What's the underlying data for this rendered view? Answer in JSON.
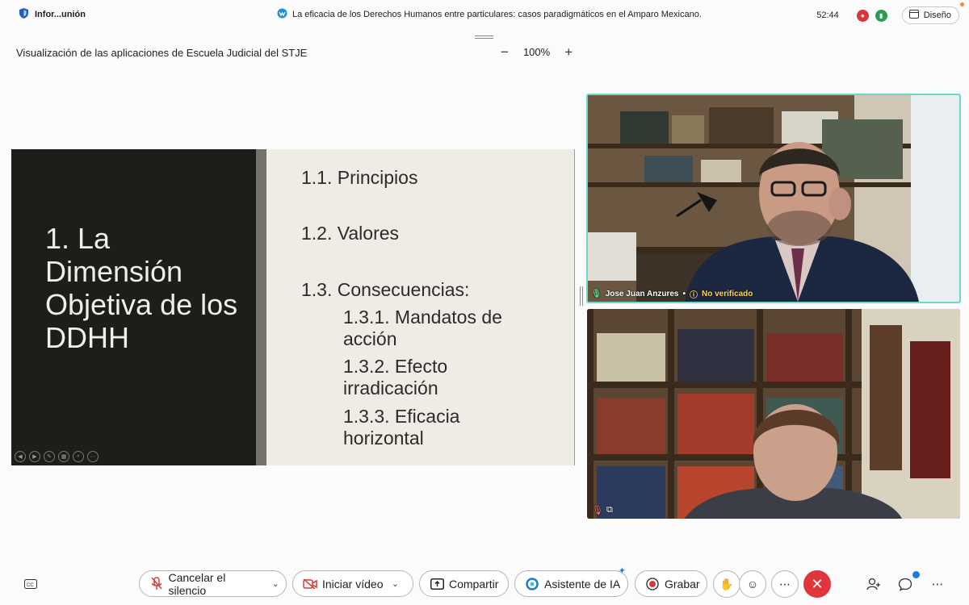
{
  "titlebar": {
    "meeting_info": "Infor...unión",
    "meeting_title": "La eficacia de los Derechos Humanos entre particulares: casos paradigmáticos en el Amparo Mexicano.",
    "timer": "52:44",
    "layout_label": "Diseño"
  },
  "share": {
    "title": "Visualización de las aplicaciones de Escuela Judicial del STJE",
    "zoom_level": "100%"
  },
  "slide": {
    "title": "1. La Dimensión Objetiva de los DDHH",
    "items": [
      "1.1. Principios",
      "1.2. Valores",
      "1.3. Consecuencias:",
      "1.3.1. Mandatos de acción",
      "1.3.2. Efecto irradicación",
      "1.3.3. Eficacia horizontal"
    ]
  },
  "participants": [
    {
      "name": "Jose Juan Anzures",
      "status": "No verificado"
    }
  ],
  "toolbar": {
    "mute_label": "Cancelar el silencio",
    "video_label": "Iniciar vídeo",
    "share_label": "Compartir",
    "ai_label": "Asistente de IA",
    "record_label": "Grabar"
  },
  "colors": {
    "active_speaker_border": "#6fd6c8",
    "end_call": "#e0353b",
    "mute_icon": "#d63a3a",
    "unverified": "#ffd45c"
  }
}
